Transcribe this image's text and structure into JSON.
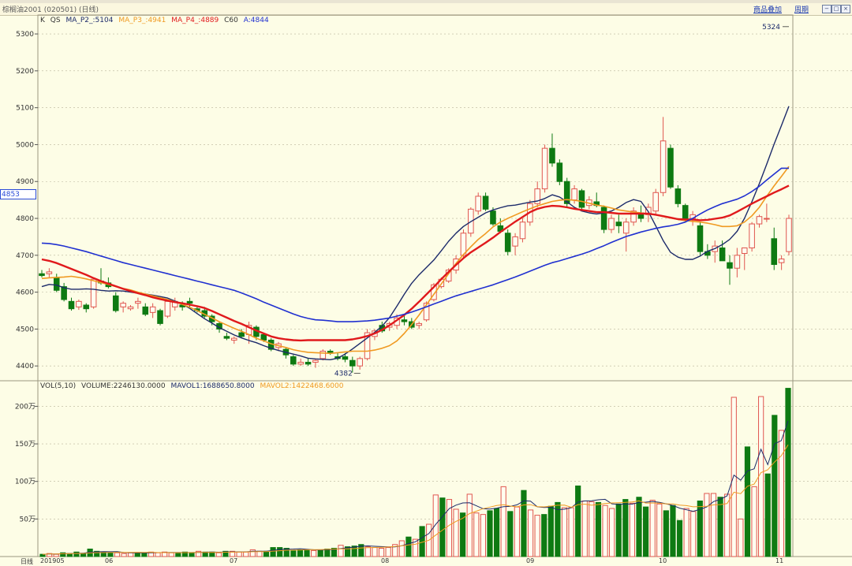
{
  "header": {
    "title": "棕榈油2001 (020501) (日线)",
    "link_add_product": "商品叠加",
    "link_period": "周期",
    "window_buttons": [
      "−",
      "□",
      "×"
    ]
  },
  "price_legend": {
    "k": "K",
    "qs": "QS",
    "ma2": "MA_P2_:5104",
    "ma3": "MA_P3_:4941",
    "ma4": "MA_P4_:4889",
    "c60": "C60",
    "a": "A:4844"
  },
  "vol_legend": {
    "vol": "VOL(5,10)",
    "volume": "VOLUME:2246130.0000",
    "mavol1": "MAVOL1:1688650.8000",
    "mavol2": "MAVOL2:1422468.6000"
  },
  "current_price_tag": "4853",
  "footer": {
    "period_label": "日线",
    "x_labels": [
      "201905",
      "06",
      "07",
      "08",
      "09",
      "10",
      "11"
    ]
  },
  "colors": {
    "up": "#e0564f",
    "down": "#0e7a12",
    "ma2": "#1c2a6a",
    "ma3": "#f09a22",
    "ma4": "#e0191c",
    "a": "#2030d0",
    "grid": "#b8b49a"
  },
  "chart_data": [
    {
      "type": "candlestick",
      "y_ticks": [
        4400,
        4500,
        4600,
        4700,
        4800,
        4900,
        5000,
        5100,
        5200,
        5300
      ],
      "ylim": [
        4362,
        5345
      ],
      "grid": true,
      "annotations": [
        {
          "text": "5324",
          "value": 5324
        },
        {
          "text": "4382",
          "value": 4382
        }
      ],
      "series": [
        {
          "name": "MA_P2_",
          "values": [
            4615,
            4621,
            4619,
            4612,
            4608,
            4608,
            4609,
            4608,
            4605,
            4603,
            4604,
            4603,
            4600,
            4597,
            4595,
            4592,
            4588,
            4584,
            4576,
            4568,
            4556,
            4542,
            4528,
            4516,
            4504,
            4494,
            4484,
            4476,
            4469,
            4463,
            4455,
            4448,
            4442,
            4437,
            4432,
            4427,
            4421,
            4419,
            4418,
            4417,
            4421,
            4432,
            4446,
            4461,
            4476,
            4491,
            4508,
            4531,
            4562,
            4594,
            4624,
            4647,
            4667,
            4687,
            4712,
            4738,
            4760,
            4778,
            4791,
            4803,
            4815,
            4823,
            4829,
            4834,
            4836,
            4840,
            4844,
            4847,
            4854,
            4864,
            4858,
            4845,
            4830,
            4820,
            4815,
            4812,
            4815,
            4820,
            4830,
            4843,
            4851,
            4846,
            4818,
            4780,
            4740,
            4708,
            4695,
            4689,
            4689,
            4698,
            4711,
            4718,
            4729,
            4743,
            4765,
            4800,
            4845,
            4894,
            4947,
            5001,
            5052,
            5104
          ]
        },
        {
          "name": "MA_P3_",
          "values": [
            4637,
            4639,
            4640,
            4641,
            4643,
            4640,
            4636,
            4631,
            4626,
            4621,
            4615,
            4610,
            4606,
            4600,
            4595,
            4590,
            4585,
            4580,
            4574,
            4567,
            4559,
            4550,
            4540,
            4530,
            4520,
            4511,
            4502,
            4494,
            4485,
            4475,
            4468,
            4460,
            4455,
            4450,
            4444,
            4440,
            4437,
            4436,
            4435,
            4434,
            4436,
            4438,
            4440,
            4440,
            4440,
            4443,
            4448,
            4455,
            4468,
            4488,
            4512,
            4538,
            4566,
            4594,
            4622,
            4650,
            4678,
            4702,
            4723,
            4743,
            4759,
            4777,
            4790,
            4800,
            4809,
            4818,
            4826,
            4834,
            4840,
            4846,
            4849,
            4851,
            4849,
            4846,
            4841,
            4836,
            4833,
            4828,
            4823,
            4820,
            4817,
            4815,
            4812,
            4810,
            4805,
            4801,
            4797,
            4794,
            4792,
            4790,
            4787,
            4783,
            4778,
            4778,
            4780,
            4790,
            4807,
            4830,
            4860,
            4888,
            4914,
            4941
          ]
        },
        {
          "name": "MA_P4_",
          "values": [
            4689,
            4685,
            4679,
            4671,
            4663,
            4655,
            4647,
            4638,
            4630,
            4623,
            4616,
            4609,
            4603,
            4597,
            4592,
            4586,
            4581,
            4577,
            4573,
            4570,
            4566,
            4562,
            4557,
            4549,
            4540,
            4531,
            4522,
            4514,
            4505,
            4496,
            4488,
            4480,
            4475,
            4472,
            4470,
            4469,
            4470,
            4470,
            4470,
            4470,
            4470,
            4470,
            4472,
            4476,
            4481,
            4488,
            4498,
            4510,
            4524,
            4538,
            4555,
            4574,
            4594,
            4614,
            4635,
            4655,
            4674,
            4692,
            4708,
            4721,
            4734,
            4748,
            4763,
            4777,
            4791,
            4804,
            4817,
            4826,
            4831,
            4834,
            4833,
            4830,
            4826,
            4823,
            4820,
            4817,
            4817,
            4815,
            4813,
            4813,
            4813,
            4813,
            4813,
            4810,
            4806,
            4802,
            4798,
            4797,
            4797,
            4795,
            4796,
            4799,
            4802,
            4808,
            4818,
            4829,
            4840,
            4850,
            4860,
            4870,
            4879,
            4889
          ]
        },
        {
          "name": "A",
          "values": [
            4733,
            4732,
            4729,
            4725,
            4720,
            4715,
            4710,
            4704,
            4698,
            4692,
            4686,
            4680,
            4675,
            4670,
            4665,
            4660,
            4655,
            4650,
            4645,
            4640,
            4635,
            4630,
            4625,
            4620,
            4615,
            4610,
            4605,
            4598,
            4590,
            4582,
            4573,
            4565,
            4557,
            4549,
            4541,
            4534,
            4529,
            4525,
            4524,
            4522,
            4520,
            4520,
            4520,
            4521,
            4522,
            4524,
            4527,
            4530,
            4535,
            4540,
            4546,
            4553,
            4560,
            4568,
            4575,
            4583,
            4590,
            4596,
            4602,
            4608,
            4614,
            4620,
            4627,
            4634,
            4641,
            4649,
            4657,
            4665,
            4673,
            4680,
            4685,
            4691,
            4697,
            4703,
            4710,
            4718,
            4726,
            4735,
            4743,
            4751,
            4757,
            4763,
            4768,
            4773,
            4777,
            4780,
            4784,
            4790,
            4800,
            4812,
            4823,
            4832,
            4840,
            4846,
            4852,
            4861,
            4873,
            4887,
            4904,
            4920,
            4936,
            4844
          ]
        }
      ],
      "candles": [
        [
          4650,
          4660,
          4640,
          4645
        ],
        [
          4650,
          4665,
          4640,
          4655
        ],
        [
          4640,
          4650,
          4600,
          4605
        ],
        [
          4615,
          4625,
          4575,
          4580
        ],
        [
          4575,
          4585,
          4550,
          4555
        ],
        [
          4560,
          4580,
          4552,
          4575
        ],
        [
          4565,
          4570,
          4545,
          4555
        ],
        [
          4560,
          4640,
          4555,
          4635
        ],
        [
          4630,
          4665,
          4620,
          4625
        ],
        [
          4625,
          4640,
          4610,
          4615
        ],
        [
          4590,
          4600,
          4545,
          4550
        ],
        [
          4560,
          4575,
          4545,
          4570
        ],
        [
          4555,
          4565,
          4550,
          4560
        ],
        [
          4570,
          4585,
          4555,
          4575
        ],
        [
          4560,
          4570,
          4535,
          4540
        ],
        [
          4545,
          4570,
          4530,
          4560
        ],
        [
          4550,
          4555,
          4510,
          4515
        ],
        [
          4535,
          4580,
          4530,
          4575
        ],
        [
          4560,
          4585,
          4550,
          4575
        ],
        [
          4565,
          4575,
          4550,
          4560
        ],
        [
          4575,
          4585,
          4560,
          4570
        ],
        [
          4555,
          4560,
          4545,
          4550
        ],
        [
          4550,
          4560,
          4530,
          4535
        ],
        [
          4535,
          4540,
          4510,
          4520
        ],
        [
          4515,
          4520,
          4490,
          4500
        ],
        [
          4480,
          4490,
          4470,
          4475
        ],
        [
          4470,
          4480,
          4460,
          4475
        ],
        [
          4490,
          4500,
          4475,
          4480
        ],
        [
          4485,
          4520,
          4460,
          4510
        ],
        [
          4505,
          4510,
          4470,
          4480
        ],
        [
          4485,
          4490,
          4465,
          4470
        ],
        [
          4470,
          4475,
          4440,
          4445
        ],
        [
          4450,
          4465,
          4440,
          4460
        ],
        [
          4445,
          4450,
          4420,
          4430
        ],
        [
          4425,
          4430,
          4400,
          4405
        ],
        [
          4405,
          4420,
          4400,
          4410
        ],
        [
          4410,
          4420,
          4400,
          4405
        ],
        [
          4410,
          4420,
          4395,
          4415
        ],
        [
          4420,
          4445,
          4415,
          4440
        ],
        [
          4440,
          4445,
          4430,
          4435
        ],
        [
          4425,
          4435,
          4415,
          4420
        ],
        [
          4425,
          4435,
          4410,
          4418
        ],
        [
          4415,
          4425,
          4382,
          4400
        ],
        [
          4400,
          4425,
          4390,
          4420
        ],
        [
          4420,
          4500,
          4415,
          4490
        ],
        [
          4480,
          4500,
          4470,
          4495
        ],
        [
          4510,
          4520,
          4490,
          4495
        ],
        [
          4505,
          4520,
          4495,
          4515
        ],
        [
          4510,
          4540,
          4500,
          4530
        ],
        [
          4525,
          4540,
          4510,
          4520
        ],
        [
          4520,
          4530,
          4500,
          4505
        ],
        [
          4510,
          4520,
          4500,
          4515
        ],
        [
          4525,
          4575,
          4520,
          4570
        ],
        [
          4580,
          4625,
          4575,
          4620
        ],
        [
          4615,
          4640,
          4610,
          4635
        ],
        [
          4630,
          4665,
          4625,
          4660
        ],
        [
          4660,
          4700,
          4650,
          4690
        ],
        [
          4700,
          4770,
          4690,
          4760
        ],
        [
          4760,
          4830,
          4750,
          4825
        ],
        [
          4820,
          4870,
          4810,
          4860
        ],
        [
          4860,
          4870,
          4820,
          4825
        ],
        [
          4820,
          4830,
          4780,
          4785
        ],
        [
          4780,
          4800,
          4760,
          4765
        ],
        [
          4760,
          4770,
          4700,
          4710
        ],
        [
          4725,
          4760,
          4700,
          4750
        ],
        [
          4745,
          4800,
          4735,
          4790
        ],
        [
          4790,
          4850,
          4780,
          4840
        ],
        [
          4840,
          4900,
          4830,
          4880
        ],
        [
          4880,
          5000,
          4870,
          4990
        ],
        [
          4990,
          5030,
          4940,
          4950
        ],
        [
          4950,
          4960,
          4890,
          4900
        ],
        [
          4900,
          4910,
          4830,
          4840
        ],
        [
          4850,
          4890,
          4840,
          4880
        ],
        [
          4875,
          4880,
          4820,
          4830
        ],
        [
          4835,
          4860,
          4825,
          4850
        ],
        [
          4845,
          4870,
          4830,
          4835
        ],
        [
          4830,
          4835,
          4760,
          4770
        ],
        [
          4770,
          4810,
          4760,
          4800
        ],
        [
          4790,
          4810,
          4760,
          4780
        ],
        [
          4760,
          4800,
          4710,
          4790
        ],
        [
          4790,
          4830,
          4780,
          4820
        ],
        [
          4815,
          4835,
          4790,
          4800
        ],
        [
          4810,
          4840,
          4790,
          4830
        ],
        [
          4820,
          4880,
          4810,
          4870
        ],
        [
          4870,
          5075,
          4860,
          5010
        ],
        [
          4990,
          5000,
          4880,
          4885
        ],
        [
          4880,
          4890,
          4830,
          4840
        ],
        [
          4835,
          4840,
          4790,
          4800
        ],
        [
          4800,
          4820,
          4780,
          4810
        ],
        [
          4780,
          4790,
          4700,
          4710
        ],
        [
          4710,
          4730,
          4690,
          4700
        ],
        [
          4710,
          4740,
          4680,
          4725
        ],
        [
          4720,
          4740,
          4700,
          4685
        ],
        [
          4680,
          4700,
          4620,
          4665
        ],
        [
          4665,
          4720,
          4640,
          4700
        ],
        [
          4705,
          4720,
          4660,
          4720
        ],
        [
          4720,
          4790,
          4710,
          4785
        ],
        [
          4785,
          4810,
          4775,
          4805
        ],
        [
          4800,
          4840,
          4790,
          4800
        ],
        [
          4745,
          4775,
          4660,
          4675
        ],
        [
          4680,
          4700,
          4660,
          4690
        ],
        [
          4710,
          4810,
          4700,
          4800
        ]
      ]
    },
    {
      "type": "bar",
      "y_ticks": [
        "50万",
        "100万",
        "150万",
        "200万"
      ],
      "y_tick_values": [
        500000,
        1000000,
        1500000,
        2000000
      ],
      "ylim": [
        0,
        2330000
      ],
      "grid": true,
      "volumes": [
        30000,
        40000,
        30000,
        50000,
        40000,
        60000,
        40000,
        100000,
        70000,
        60000,
        50000,
        50000,
        40000,
        50000,
        50000,
        50000,
        60000,
        50000,
        60000,
        50000,
        50000,
        60000,
        50000,
        70000,
        60000,
        60000,
        50000,
        70000,
        70000,
        60000,
        60000,
        90000,
        70000,
        70000,
        120000,
        120000,
        110000,
        80000,
        90000,
        90000,
        80000,
        90000,
        100000,
        110000,
        150000,
        130000,
        140000,
        160000,
        130000,
        120000,
        110000,
        120000,
        160000,
        210000,
        260000,
        230000,
        400000,
        430000,
        820000,
        780000,
        760000,
        630000,
        580000,
        830000,
        580000,
        560000,
        610000,
        640000,
        930000,
        600000,
        660000,
        880000,
        620000,
        550000,
        560000,
        670000,
        720000,
        650000,
        650000,
        940000,
        740000,
        730000,
        720000,
        680000,
        640000,
        700000,
        760000,
        710000,
        790000,
        660000,
        750000,
        700000,
        610000,
        680000,
        480000,
        640000,
        600000,
        740000,
        840000,
        840000,
        790000,
        830000,
        2120000,
        500000,
        1460000,
        930000,
        2130000,
        1100000,
        1880000,
        1680000,
        2240000
      ]
    }
  ]
}
